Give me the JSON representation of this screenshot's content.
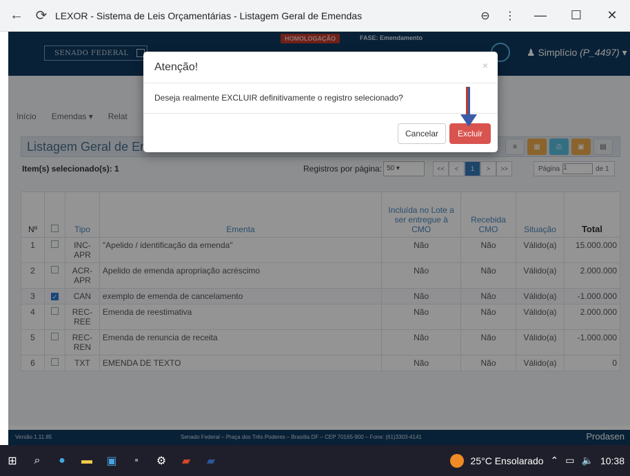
{
  "browser": {
    "title": "LEXOR - Sistema de Leis Orçamentárias - Listagem Geral de Emendas",
    "zoom_icon": "zoom-out-icon",
    "menu_icon": "kebab-menu-icon"
  },
  "header": {
    "logo_text": "SENADO FEDERAL",
    "env_badge": "HOMOLOGAÇÃO",
    "phase": "FASE: Emendamento",
    "user_label": "Simplício",
    "user_code": "(P_4497)"
  },
  "nav": {
    "items": [
      "Início",
      "Emendas ▾",
      "Relat"
    ]
  },
  "panel": {
    "title": "Listagem Geral de Em"
  },
  "list": {
    "selected_info": "Item(s) selecionado(s): 1",
    "rpp_label": "Registros por página:",
    "rpp_value": "50",
    "pager": [
      "<<",
      "<",
      "1",
      ">",
      ">>"
    ],
    "page_label": "Página",
    "page_value": "1",
    "page_of": "de 1"
  },
  "table": {
    "headers": [
      "Nº",
      "",
      "Tipo",
      "Ementa",
      "Incluída no Lote a ser entregue à CMO",
      "Recebida CMO",
      "Situação",
      "Total"
    ],
    "rows": [
      {
        "n": "1",
        "checked": false,
        "tipo": "INC-APR",
        "ementa": "\"Apelido / identificação da emenda\"",
        "lote": "Não",
        "recebida": "Não",
        "situacao": "Válido(a)",
        "total": "15.000.000"
      },
      {
        "n": "2",
        "checked": false,
        "tipo": "ACR-APR",
        "ementa": "Apelido de emenda apropriação acréscimo",
        "lote": "Não",
        "recebida": "Não",
        "situacao": "Válido(a)",
        "total": "2.000.000"
      },
      {
        "n": "3",
        "checked": true,
        "tipo": "CAN",
        "ementa": "exemplo de emenda de cancelamento",
        "lote": "Não",
        "recebida": "Não",
        "situacao": "Válido(a)",
        "total": "-1.000.000"
      },
      {
        "n": "4",
        "checked": false,
        "tipo": "REC-REE",
        "ementa": "Emenda de reestimativa",
        "lote": "Não",
        "recebida": "Não",
        "situacao": "Válido(a)",
        "total": "2.000.000"
      },
      {
        "n": "5",
        "checked": false,
        "tipo": "REC-REN",
        "ementa": "Emenda de renuncia de receita",
        "lote": "Não",
        "recebida": "Não",
        "situacao": "Válido(a)",
        "total": "-1.000.000"
      },
      {
        "n": "6",
        "checked": false,
        "tipo": "TXT",
        "ementa": "EMENDA DE TEXTO",
        "lote": "Não",
        "recebida": "Não",
        "situacao": "Válido(a)",
        "total": "0"
      }
    ]
  },
  "footer": {
    "version": "Versão 1.11.85",
    "address": "Senado Federal – Praça dos Três Poderes – Brasília DF – CEP 70165-900 – Fone: (61)3303-4141",
    "brand": "Prodasen"
  },
  "modal": {
    "title": "Atenção!",
    "close": "×",
    "message": "Deseja realmente EXCLUIR definitivamente o registro selecionado?",
    "cancel_label": "Cancelar",
    "confirm_label": "Excluir"
  },
  "taskbar": {
    "weather": "25°C Ensolarado",
    "clock": "10:38"
  },
  "colors": {
    "header_bg": "#0f3a5f",
    "danger": "#d9534f",
    "primary": "#337ab7",
    "negative": "#d64545"
  }
}
